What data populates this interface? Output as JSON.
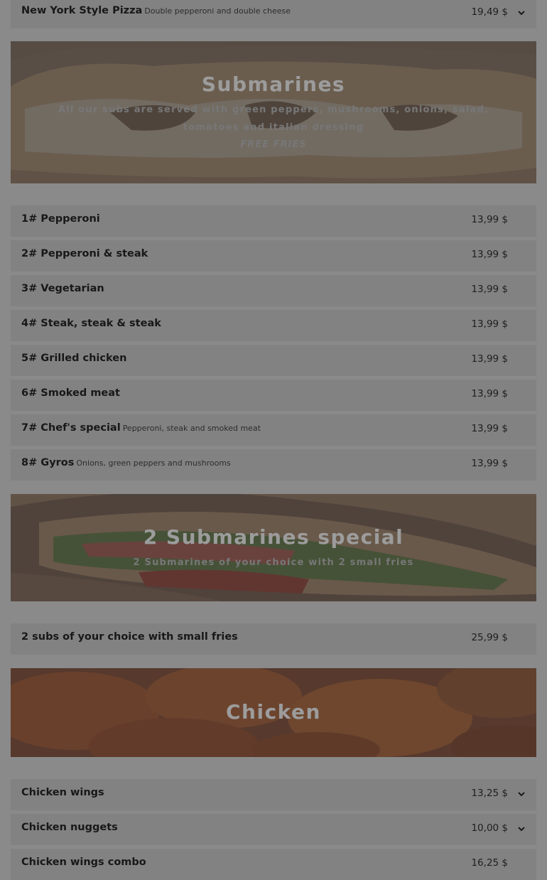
{
  "top_item": {
    "name": "New York Style Pizza",
    "desc": "Double pepperoni and double cheese",
    "price": "19,49 $"
  },
  "submarines": {
    "title": "Submarines",
    "subtitle": "All our subs are served with green peppers, mushrooms, onions, salad, tomatoes and italian dressing",
    "note": "FREE FRIES",
    "items": [
      {
        "name": "1# Pepperoni",
        "desc": "",
        "price": "13,99 $"
      },
      {
        "name": "2# Pepperoni & steak",
        "desc": "",
        "price": "13,99 $"
      },
      {
        "name": "3# Vegetarian",
        "desc": "",
        "price": "13,99 $"
      },
      {
        "name": "4# Steak, steak & steak",
        "desc": "",
        "price": "13,99 $"
      },
      {
        "name": "5# Grilled chicken",
        "desc": "",
        "price": "13,99 $"
      },
      {
        "name": "6# Smoked meat",
        "desc": "",
        "price": "13,99 $"
      },
      {
        "name": "7# Chef's special",
        "desc": "Pepperoni, steak and smoked meat",
        "price": "13,99 $"
      },
      {
        "name": "8# Gyros",
        "desc": "Onions, green peppers and mushrooms",
        "price": "13,99 $"
      }
    ]
  },
  "special": {
    "title": "2 Submarines special",
    "subtitle": "2 Submarines of your choice with 2 small fries",
    "item": {
      "name": "2 subs of your choice with small fries",
      "price": "25,99 $"
    }
  },
  "chicken": {
    "title": "Chicken",
    "items": [
      {
        "name": "Chicken wings",
        "price": "13,25 $"
      },
      {
        "name": "Chicken nuggets",
        "price": "10,00 $"
      },
      {
        "name": "Chicken wings combo",
        "price": "16,25 $"
      }
    ]
  },
  "icons": {
    "expand": "chevron-down-icon"
  },
  "colors": {
    "overlay": "#8a8a8a",
    "row": "#828282"
  }
}
